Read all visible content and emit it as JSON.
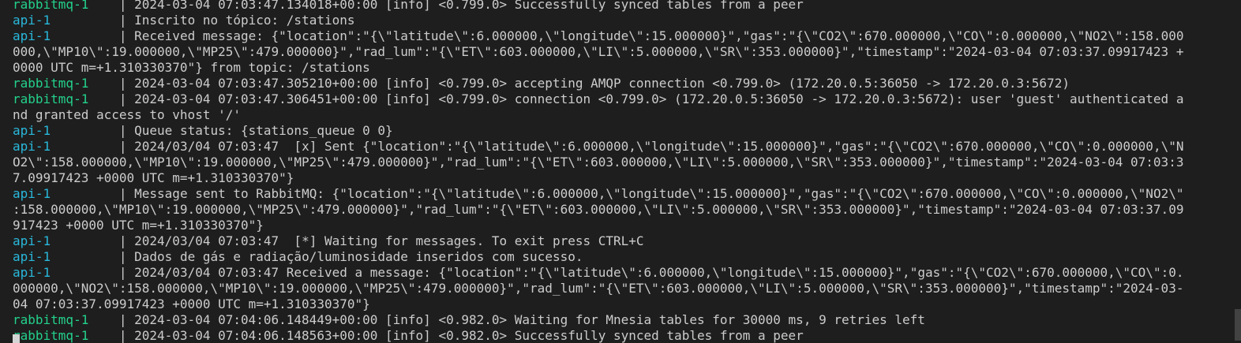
{
  "colors": {
    "background": "#1e1e1e",
    "text": "#cccccc",
    "api": "#29b8db",
    "rabbitmq": "#23d18b"
  },
  "terminal": {
    "rows": [
      {
        "svc": "rabbitmq-1",
        "color": "rabbitmq",
        "sep": "    | ",
        "text": "2024-03-04 07:03:47.134018+00:00 [info] <0.799.0> Successfully synced tables from a peer"
      },
      {
        "svc": "api-1",
        "color": "api",
        "sep": "         | ",
        "text": "Inscrito no tópico: /stations"
      },
      {
        "svc": "api-1",
        "color": "api",
        "sep": "         | ",
        "text": "Received message: {\"location\":\"{\\\"latitude\\\":6.000000,\\\"longitude\\\":15.000000}\",\"gas\":\"{\\\"CO2\\\":670.000000,\\\"CO\\\":0.000000,\\\"NO2\\\":158.000"
      },
      {
        "text": "000,\\\"MP10\\\":19.000000,\\\"MP25\\\":479.000000}\",\"rad_lum\":\"{\\\"ET\\\":603.000000,\\\"LI\\\":5.000000,\\\"SR\\\":353.000000}\",\"timestamp\":\"2024-03-04 07:03:37.09917423 +"
      },
      {
        "text": "0000 UTC m=+1.310330370\"} from topic: /stations"
      },
      {
        "svc": "rabbitmq-1",
        "color": "rabbitmq",
        "sep": "    | ",
        "text": "2024-03-04 07:03:47.305210+00:00 [info] <0.799.0> accepting AMQP connection <0.799.0> (172.20.0.5:36050 -> 172.20.0.3:5672)"
      },
      {
        "svc": "rabbitmq-1",
        "color": "rabbitmq",
        "sep": "    | ",
        "text": "2024-03-04 07:03:47.306451+00:00 [info] <0.799.0> connection <0.799.0> (172.20.0.5:36050 -> 172.20.0.3:5672): user 'guest' authenticated a"
      },
      {
        "text": "nd granted access to vhost '/'"
      },
      {
        "svc": "api-1",
        "color": "api",
        "sep": "         | ",
        "text": "Queue status: {stations_queue 0 0}"
      },
      {
        "svc": "api-1",
        "color": "api",
        "sep": "         | ",
        "text": "2024/03/04 07:03:47  [x] Sent {\"location\":\"{\\\"latitude\\\":6.000000,\\\"longitude\\\":15.000000}\",\"gas\":\"{\\\"CO2\\\":670.000000,\\\"CO\\\":0.000000,\\\"N"
      },
      {
        "text": "O2\\\":158.000000,\\\"MP10\\\":19.000000,\\\"MP25\\\":479.000000}\",\"rad_lum\":\"{\\\"ET\\\":603.000000,\\\"LI\\\":5.000000,\\\"SR\\\":353.000000}\",\"timestamp\":\"2024-03-04 07:03:3"
      },
      {
        "text": "7.09917423 +0000 UTC m=+1.310330370\"}"
      },
      {
        "svc": "api-1",
        "color": "api",
        "sep": "         | ",
        "text": "Message sent to RabbitMQ: {\"location\":\"{\\\"latitude\\\":6.000000,\\\"longitude\\\":15.000000}\",\"gas\":\"{\\\"CO2\\\":670.000000,\\\"CO\\\":0.000000,\\\"NO2\\\""
      },
      {
        "text": ":158.000000,\\\"MP10\\\":19.000000,\\\"MP25\\\":479.000000}\",\"rad_lum\":\"{\\\"ET\\\":603.000000,\\\"LI\\\":5.000000,\\\"SR\\\":353.000000}\",\"timestamp\":\"2024-03-04 07:03:37.09"
      },
      {
        "text": "917423 +0000 UTC m=+1.310330370\"}"
      },
      {
        "svc": "api-1",
        "color": "api",
        "sep": "         | ",
        "text": "2024/03/04 07:03:47  [*] Waiting for messages. To exit press CTRL+C"
      },
      {
        "svc": "api-1",
        "color": "api",
        "sep": "         | ",
        "text": "Dados de gás e radiação/luminosidade inseridos com sucesso."
      },
      {
        "svc": "api-1",
        "color": "api",
        "sep": "         | ",
        "text": "2024/03/04 07:03:47 Received a message: {\"location\":\"{\\\"latitude\\\":6.000000,\\\"longitude\\\":15.000000}\",\"gas\":\"{\\\"CO2\\\":670.000000,\\\"CO\\\":0."
      },
      {
        "text": "000000,\\\"NO2\\\":158.000000,\\\"MP10\\\":19.000000,\\\"MP25\\\":479.000000}\",\"rad_lum\":\"{\\\"ET\\\":603.000000,\\\"LI\\\":5.000000,\\\"SR\\\":353.000000}\",\"timestamp\":\"2024-03-"
      },
      {
        "text": "04 07:03:37.09917423 +0000 UTC m=+1.310330370\"}"
      },
      {
        "svc": "rabbitmq-1",
        "color": "rabbitmq",
        "sep": "    | ",
        "text": "2024-03-04 07:04:06.148449+00:00 [info] <0.982.0> Waiting for Mnesia tables for 30000 ms, 9 retries left"
      },
      {
        "svc": "rabbitmq-1",
        "color": "rabbitmq",
        "sep": "    | ",
        "text": "2024-03-04 07:04:06.148563+00:00 [info] <0.982.0> Successfully synced tables from a peer"
      }
    ]
  }
}
